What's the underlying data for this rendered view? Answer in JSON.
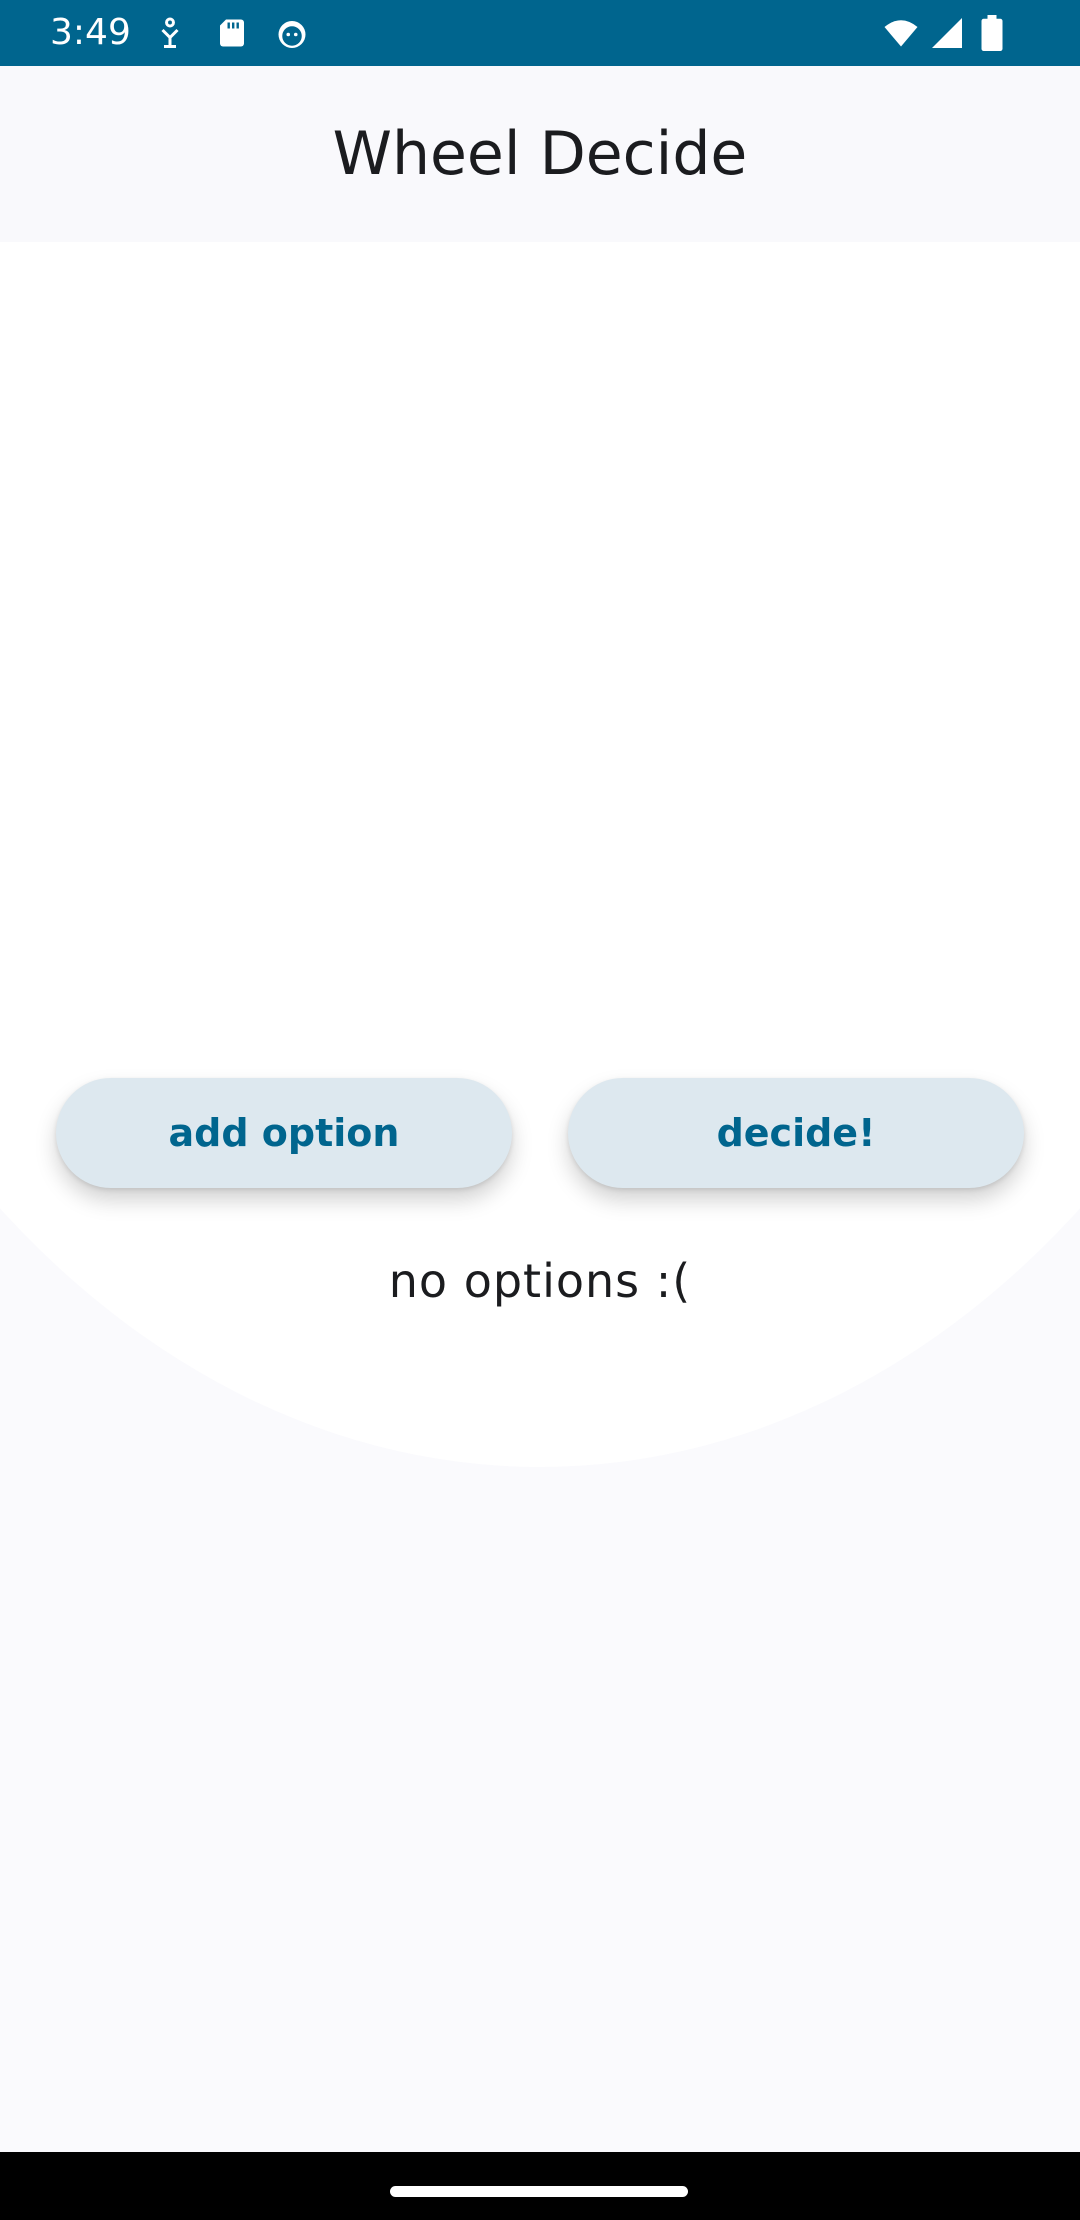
{
  "status_bar": {
    "time": "3:49",
    "background_color": "#00658e",
    "icons": [
      "accessibility-icon",
      "sd-card-icon",
      "android-head-icon",
      "wifi-icon",
      "cell-signal-icon",
      "battery-icon"
    ]
  },
  "app_bar": {
    "title": "Wheel Decide"
  },
  "actions": {
    "add_option_label": "add option",
    "decide_label": "decide!"
  },
  "wheel": {
    "empty_message": "no options :("
  },
  "colors": {
    "accent": "#00658e",
    "button_bg": "#dde8ef",
    "surface": "#fafafd"
  }
}
